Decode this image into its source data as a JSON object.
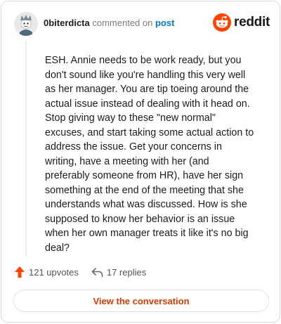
{
  "header": {
    "username": "0biterdicta",
    "action_text": " commented on ",
    "target_link": "post",
    "brand_name": "reddit"
  },
  "comment": {
    "body": "ESH. Annie needs to be work ready, but you don't sound like you're handling this very well as her manager. You are tip toeing around the actual issue instead of dealing with it head on. Stop giving way to these \"new normal\" excuses, and start taking some actual action to address the issue. Get your concerns in writing, have a meeting with her (and preferably someone from HR), have her sign something at the end of the meeting that she understands what was discussed. How is she supposed to know her behavior is an issue when her own manager treats it like it's no big deal?"
  },
  "footer": {
    "upvotes": "121 upvotes",
    "replies": "17 replies",
    "cta_label": "View the conversation"
  },
  "icons": {
    "avatar": "user-avatar-icon",
    "brand": "reddit-logo-icon",
    "upvote": "upvote-arrow-icon",
    "reply": "reply-arrow-icon"
  },
  "colors": {
    "brand_orange": "#ff4500",
    "link_blue": "#0079d3",
    "cta_text": "#d93a00"
  }
}
